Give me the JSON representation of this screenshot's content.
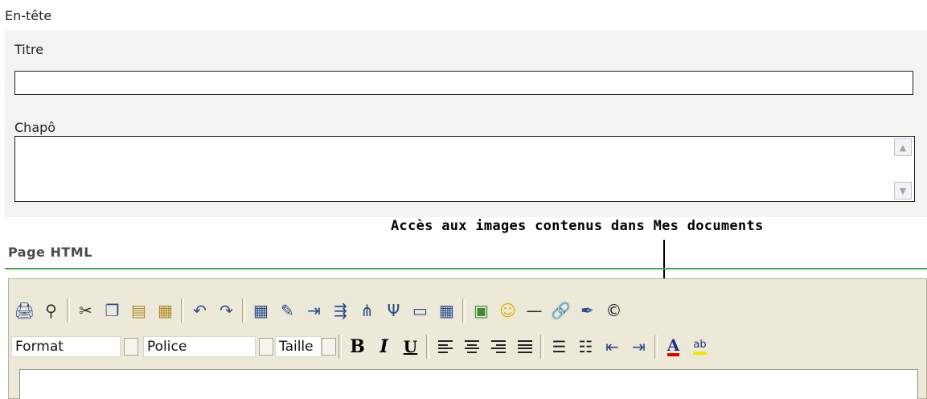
{
  "header": {
    "section_label": "En-tête",
    "title_label": "Titre",
    "title_value": "",
    "lead_label": "Chapô",
    "lead_value": ""
  },
  "annotation": {
    "text": "Accès aux images contenus dans Mes documents"
  },
  "editor": {
    "section_label": "Page HTML",
    "format_label": "Format",
    "font_label": "Police",
    "size_label": "Taille",
    "content": ""
  },
  "icons": {
    "toolbar_row1": [
      "print-icon",
      "find-icon",
      "cut-icon",
      "copy-icon",
      "paste-icon",
      "paste-word-icon",
      "undo-icon",
      "redo-icon",
      "table-icon",
      "edit-table-icon",
      "insert-column-icon",
      "insert-row-icon",
      "merge-cells-icon",
      "split-cells-icon",
      "table-properties-icon",
      "cell-properties-icon",
      "image-icon",
      "smiley-icon",
      "horizontal-rule-icon",
      "link-icon",
      "anchor-icon",
      "copyright-icon"
    ],
    "toolbar_row2": [
      "bold-icon",
      "italic-icon",
      "underline-icon",
      "align-left-icon",
      "align-center-icon",
      "align-right-icon",
      "justify-icon",
      "ordered-list-icon",
      "unordered-list-icon",
      "outdent-icon",
      "indent-icon",
      "font-color-icon",
      "highlight-icon"
    ]
  },
  "colors": {
    "panel_bg": "#f1f4f1",
    "divider_green": "#4aa84a",
    "toolbar_bg": "#ece9d8"
  }
}
